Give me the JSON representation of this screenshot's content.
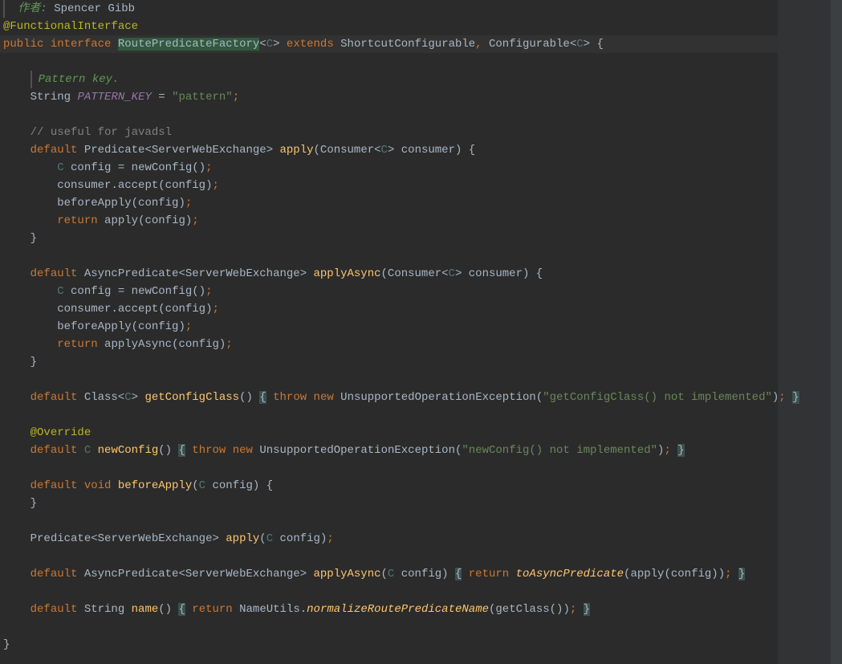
{
  "doc": {
    "author_label": "作者:",
    "author_name": "Spencer Gibb"
  },
  "annotations": {
    "functional_interface": "@FunctionalInterface",
    "override": "@Override"
  },
  "decl": {
    "public": "public",
    "interface": "interface",
    "class_name": "RoutePredicateFactory",
    "generic_open": "<",
    "generic_c": "C",
    "generic_close": ">",
    "extends": "extends",
    "super1": "ShortcutConfigurable",
    "comma": ", ",
    "super2": "Configurable",
    "brace_open": "{"
  },
  "pattern": {
    "doc": "Pattern key.",
    "type": "String",
    "name": "PATTERN_KEY",
    "eq": " = ",
    "value": "\"pattern\"",
    "semi": ";"
  },
  "comment_javadsl": "// useful for javadsl",
  "kw": {
    "default": "default",
    "return": "return",
    "void": "void",
    "throw": "throw",
    "new": "new"
  },
  "types": {
    "Predicate": "Predicate",
    "ServerWebExchange": "ServerWebExchange",
    "AsyncPredicate": "AsyncPredicate",
    "Consumer": "Consumer",
    "Class": "Class",
    "String": "String",
    "UnsupportedOp": "UnsupportedOperationException",
    "NameUtils": "NameUtils",
    "C": "C"
  },
  "methods": {
    "apply": "apply",
    "applyAsync": "applyAsync",
    "newConfig": "newConfig",
    "accept": "accept",
    "beforeApply": "beforeApply",
    "getConfigClass": "getConfigClass",
    "name": "name",
    "toAsyncPredicate": "toAsyncPredicate",
    "normalizeRoutePredicateName": "normalizeRoutePredicateName",
    "getClass": "getClass"
  },
  "vars": {
    "consumer": "consumer",
    "config": "config"
  },
  "strings": {
    "getConfigClass_msg": "\"getConfigClass() not implemented\"",
    "newConfig_msg": "\"newConfig() not implemented\""
  },
  "sym": {
    "lt": "<",
    "gt": ">",
    "lp": "(",
    "rp": ")",
    "lb": "{",
    "rb": "}",
    "semi": ";",
    "eq": " = ",
    "dot": "."
  }
}
